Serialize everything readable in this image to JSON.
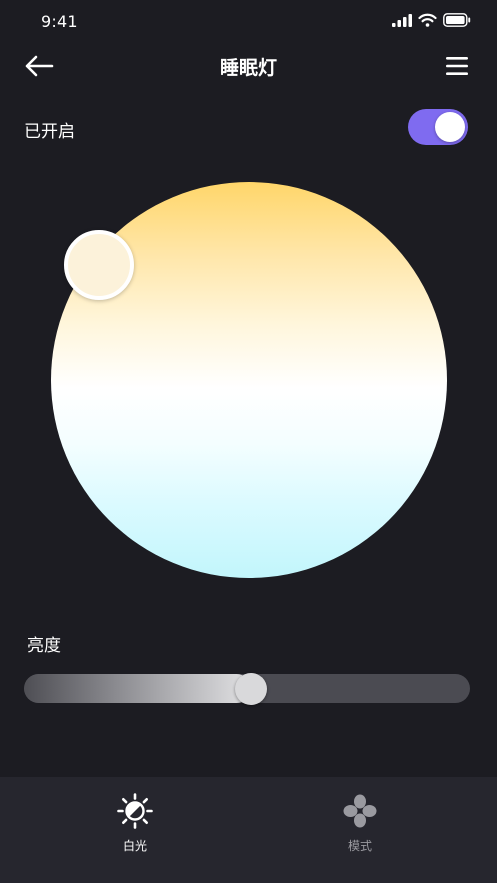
{
  "status_bar": {
    "time": "9:41"
  },
  "nav": {
    "title": "睡眠灯"
  },
  "power": {
    "label": "已开启",
    "on": true
  },
  "color_wheel": {
    "selected_color": "#fcf2da"
  },
  "brightness": {
    "label": "亮度",
    "value": 0.51
  },
  "tabs": [
    {
      "label": "白光",
      "active": true
    },
    {
      "label": "模式",
      "active": false
    }
  ],
  "colors": {
    "accent": "#7f6bf0",
    "background": "#1c1c22",
    "tab_bar": "#26262e",
    "inactive_tab": "#9a9aa0"
  },
  "icons": {
    "back": "arrow-left-icon",
    "menu": "hamburger-menu-icon",
    "white_light": "sun-icon",
    "mode": "four-petal-icon"
  }
}
